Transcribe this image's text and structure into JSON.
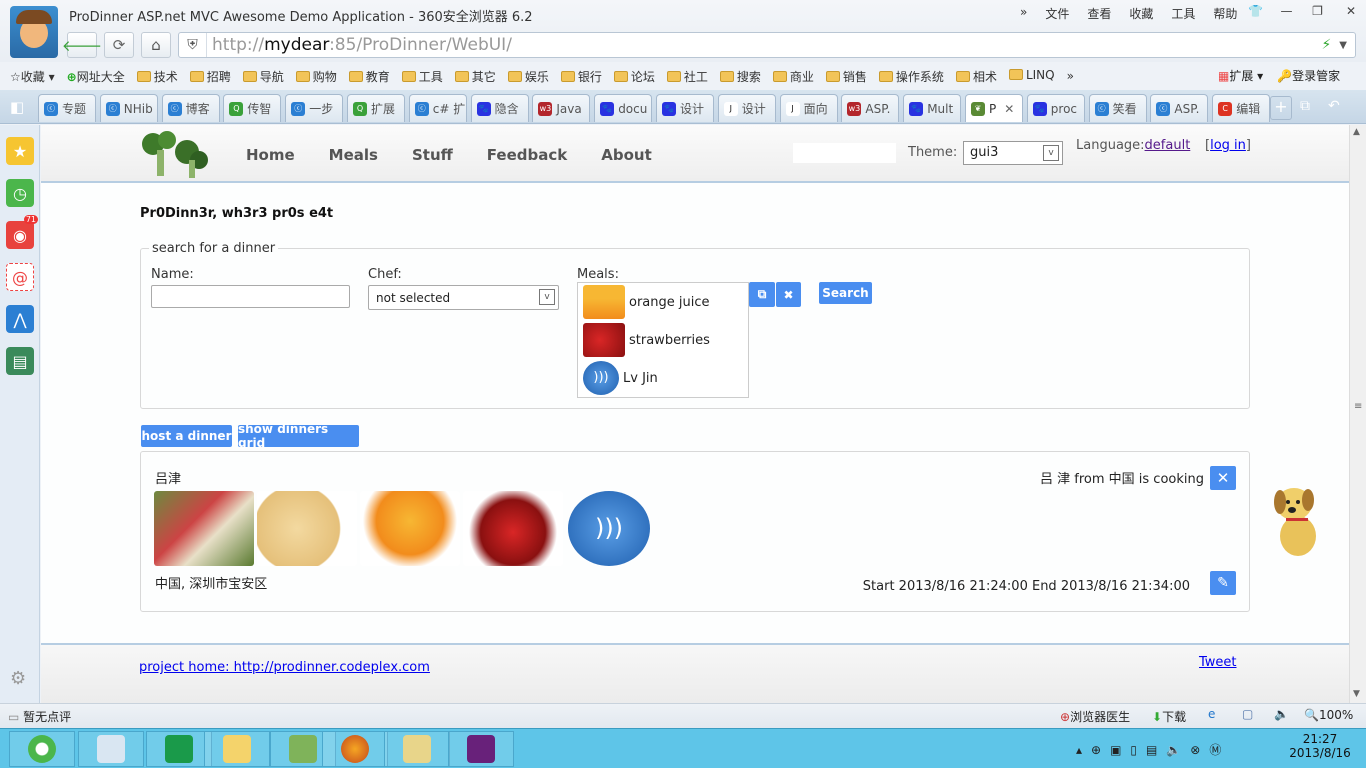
{
  "browser": {
    "title": "ProDinner ASP.net MVC Awesome Demo Application - 360安全浏览器 6.2",
    "menu": [
      "»",
      "文件",
      "查看",
      "收藏",
      "工具",
      "帮助"
    ],
    "url_prefix": "http://",
    "url_host": "mydear",
    "url_rest": ":85/ProDinner/WebUI/",
    "bookmarks": {
      "favorites": "收藏",
      "site_nav": "网址大全",
      "folders": [
        "技术",
        "招聘",
        "导航",
        "购物",
        "教育",
        "工具",
        "其它",
        "娱乐",
        "银行",
        "论坛",
        "社工",
        "搜索",
        "商业",
        "销售",
        "操作系统",
        "相术",
        "LINQ"
      ],
      "more": "»",
      "extensions": "扩展",
      "login_manager": "登录管家"
    },
    "tabs": [
      {
        "label": "专题",
        "icon": "cnblogs"
      },
      {
        "label": "NHib",
        "icon": "cnblogs"
      },
      {
        "label": "博客",
        "icon": "cnblogs"
      },
      {
        "label": "传智",
        "icon": "search-green"
      },
      {
        "label": "一步",
        "icon": "cnblogs"
      },
      {
        "label": "扩展",
        "icon": "search-green"
      },
      {
        "label": "c# 扩",
        "icon": "cnblogs"
      },
      {
        "label": "隐含",
        "icon": "baidu"
      },
      {
        "label": "Java",
        "icon": "w3"
      },
      {
        "label": "docu",
        "icon": "baidu"
      },
      {
        "label": "设计",
        "icon": "baidu"
      },
      {
        "label": "设计",
        "icon": "j"
      },
      {
        "label": "面向",
        "icon": "j"
      },
      {
        "label": "ASP.",
        "icon": "w3"
      },
      {
        "label": "Mult",
        "icon": "baidu"
      },
      {
        "label": "P",
        "icon": "broccoli",
        "active": true
      },
      {
        "label": "proc",
        "icon": "baidu"
      },
      {
        "label": "笑看",
        "icon": "cnblogs"
      },
      {
        "label": "ASP.",
        "icon": "cnblogs"
      },
      {
        "label": "编辑",
        "icon": "c-red"
      }
    ],
    "sidebar_badge": "71",
    "status": {
      "comment": "暂无点评",
      "doctor": "浏览器医生",
      "download": "下载",
      "zoom": "100%"
    }
  },
  "app": {
    "nav": [
      "Home",
      "Meals",
      "Stuff",
      "Feedback",
      "About"
    ],
    "theme_label": "Theme:",
    "theme_value": "gui3",
    "language_label": "Language:",
    "language_value": "default",
    "login_open": "[",
    "login": "log in",
    "login_close": "]",
    "motto": "Pr0Dinn3r, wh3r3 pr0s e4t",
    "search": {
      "legend": "search for a dinner",
      "name_label": "Name:",
      "name_value": "",
      "chef_label": "Chef:",
      "chef_value": "not selected",
      "meals_label": "Meals:",
      "meals": [
        "orange juice",
        "strawberries",
        "Lv Jin"
      ],
      "search_button": "Search"
    },
    "buttons": {
      "host": "host a dinner",
      "grid": "show dinners grid"
    },
    "dinner": {
      "name": "吕津",
      "chef_line": "吕 津 from 中国 is cooking",
      "address": "中国, 深圳市宝安区",
      "time": "Start 2013/8/16 21:24:00 End 2013/8/16 21:34:00"
    },
    "footer": {
      "link": "project home: http://prodinner.codeplex.com",
      "tweet": "Tweet"
    }
  },
  "taskbar": {
    "time": "21:27",
    "date": "2013/8/16"
  },
  "colors": {
    "accent": "#4a8ef0",
    "taskbar": "#5ec5e8"
  }
}
